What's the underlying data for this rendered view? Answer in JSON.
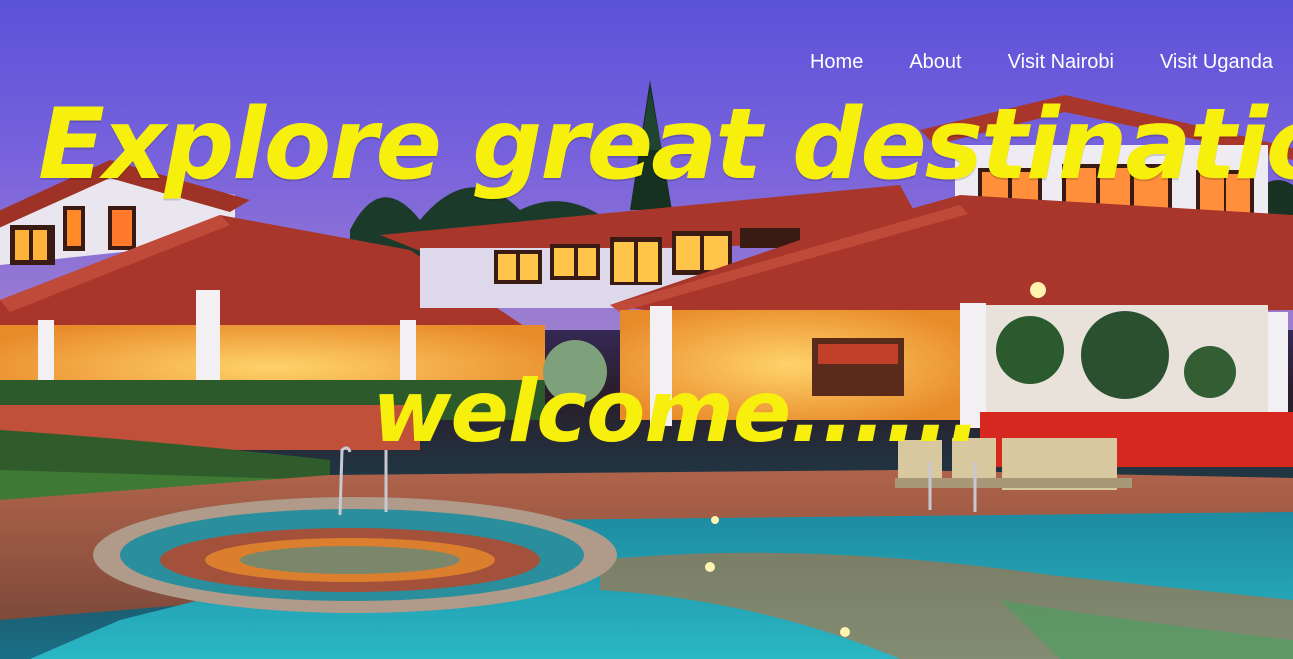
{
  "nav": {
    "items": [
      {
        "label": "Home"
      },
      {
        "label": "About"
      },
      {
        "label": "Visit Nairobi"
      },
      {
        "label": "Visit Uganda"
      }
    ]
  },
  "hero": {
    "headline": "Explore great destinations",
    "subheadline": "welcome......",
    "image_semantic": "resort-with-pool-hero-image",
    "colors": {
      "headline": "#f7f00c",
      "nav_text": "#ffffff",
      "sky": "#6d5fe0",
      "roof": "#a8362a",
      "pool": "#1fa7b8"
    }
  }
}
